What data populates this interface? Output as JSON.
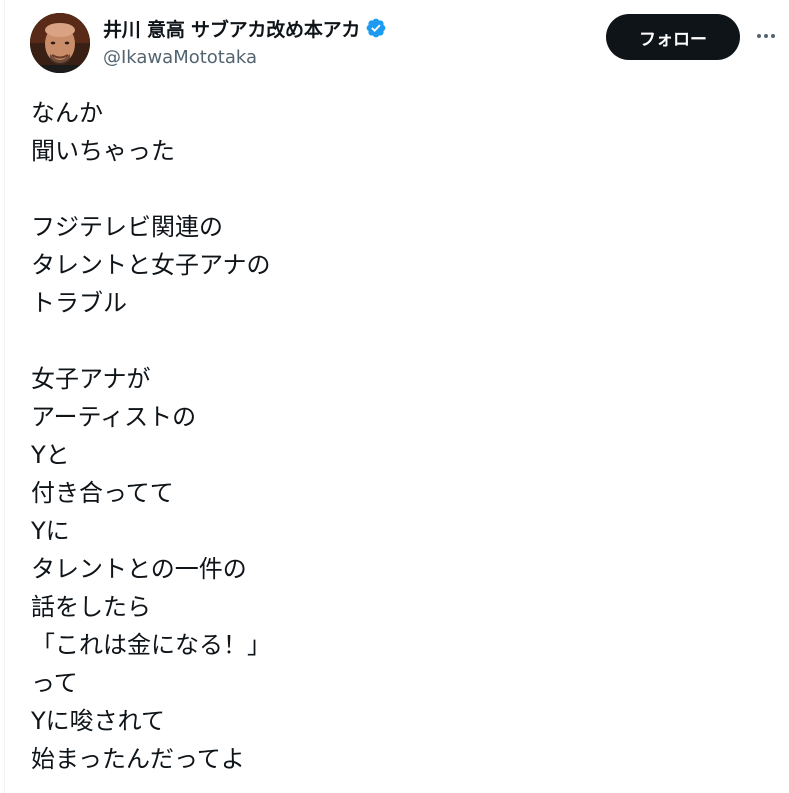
{
  "author": {
    "display_name": "井川 意高 サブアカ改め本アカ",
    "handle": "@IkawaMototaka",
    "verified_icon": "verified-badge-icon"
  },
  "actions": {
    "follow_label": "フォロー",
    "more_icon": "more-options-icon"
  },
  "post": {
    "lines": [
      "なんか",
      "聞いちゃった",
      "",
      "フジテレビ関連の",
      "タレントと女子アナの",
      "トラブル",
      "",
      "女子アナが",
      "アーティストの",
      "Yと",
      "付き合ってて",
      "Yに",
      "タレントとの一件の",
      "話をしたら",
      "「これは金になる！」",
      "って",
      "Yに唆されて",
      "始まったんだってよ"
    ]
  },
  "colors": {
    "text": "#0f1419",
    "secondary": "#536471",
    "verified": "#1d9bf0",
    "follow_bg": "#0f1419",
    "follow_text": "#ffffff"
  }
}
